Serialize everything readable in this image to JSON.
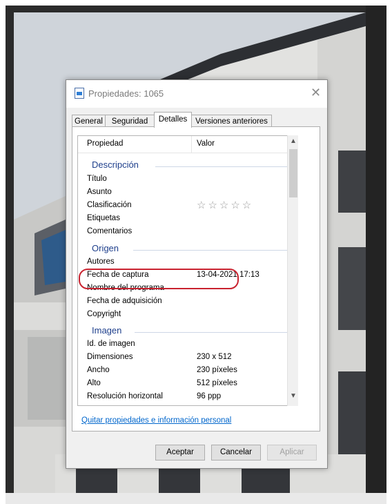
{
  "dialog": {
    "title": "Propiedades: 1065",
    "tabs": [
      {
        "label": "General"
      },
      {
        "label": "Seguridad"
      },
      {
        "label": "Detalles"
      },
      {
        "label": "Versiones anteriores"
      }
    ],
    "active_tab": "Detalles",
    "columns": {
      "property": "Propiedad",
      "value": "Valor"
    },
    "groups": {
      "description": "Descripción",
      "origin": "Origen",
      "image": "Imagen"
    },
    "rows": {
      "titulo": {
        "name": "Título",
        "value": ""
      },
      "asunto": {
        "name": "Asunto",
        "value": ""
      },
      "clasificacion": {
        "name": "Clasificación",
        "value": "☆☆☆☆☆"
      },
      "etiquetas": {
        "name": "Etiquetas",
        "value": ""
      },
      "comentarios": {
        "name": "Comentarios",
        "value": ""
      },
      "autores": {
        "name": "Autores",
        "value": ""
      },
      "fecha_captura": {
        "name": "Fecha de captura",
        "value": "13-04-2021 17:13"
      },
      "nombre_programa": {
        "name": "Nombre del programa",
        "value": ""
      },
      "fecha_adquisicion": {
        "name": "Fecha de adquisición",
        "value": ""
      },
      "copyright": {
        "name": "Copyright",
        "value": ""
      },
      "id_imagen": {
        "name": "Id. de imagen",
        "value": ""
      },
      "dimensiones": {
        "name": "Dimensiones",
        "value": "230 x 512"
      },
      "ancho": {
        "name": "Ancho",
        "value": "230 píxeles"
      },
      "alto": {
        "name": "Alto",
        "value": "512 píxeles"
      },
      "resolucion_horizontal": {
        "name": "Resolución horizontal",
        "value": "96 ppp"
      }
    },
    "remove_link": "Quitar propiedades e información personal",
    "buttons": {
      "accept": "Aceptar",
      "cancel": "Cancelar",
      "apply": "Aplicar"
    }
  },
  "icons": {
    "title_icon": "image-file-icon",
    "close": "close-icon",
    "scroll_up": "chevron-up-icon",
    "scroll_down": "chevron-down-icon"
  },
  "colors": {
    "highlight": "#c9222f",
    "group_header": "#1e3f8c",
    "link": "#0066cc"
  }
}
